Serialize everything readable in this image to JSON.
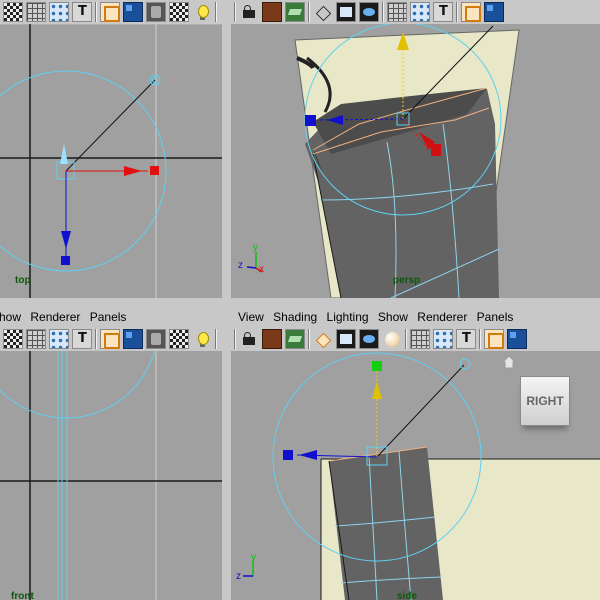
{
  "panes": {
    "top": {
      "label": "top"
    },
    "persp": {
      "label": "persp"
    },
    "front": {
      "label": "front",
      "menu": [
        "how",
        "Renderer",
        "Panels"
      ]
    },
    "side": {
      "label": "side",
      "menu": [
        "View",
        "Shading",
        "Lighting",
        "Show",
        "Renderer",
        "Panels"
      ],
      "viewcube_label": "RIGHT"
    }
  },
  "axes": {
    "x": "x",
    "y": "y",
    "z": "z"
  },
  "colors": {
    "viewport_bg": "#a0a0a0",
    "ui_bg": "#c8c8c8",
    "manip_circle": "#5fd0f0",
    "image_plane": "#e8e8c8",
    "axis_x": "#d01010",
    "axis_y": "#10c010",
    "axis_z": "#1010d0",
    "mesh": "#606060"
  },
  "toolbar_icons": {
    "top": [
      "checker-icon",
      "grid-icon",
      "dots-icon",
      "text-icon",
      "separator",
      "cube-outline-icon",
      "cube-blue-icon",
      "cube-gray-icon",
      "checker-icon",
      "bulb-icon",
      "separator"
    ],
    "persp": [
      "separator",
      "camera-icon",
      "book-icon",
      "layers-icon",
      "separator",
      "diamond-icon",
      "film-icon",
      "eye-icon",
      "separator",
      "grid-icon",
      "dots-icon",
      "text-icon",
      "separator",
      "cube-outline-icon",
      "cube-blue-icon"
    ],
    "front": [
      "checker-icon",
      "grid-icon",
      "dots-icon",
      "text-icon",
      "separator",
      "cube-outline-icon",
      "cube-blue-icon",
      "cube-gray-icon",
      "checker-icon",
      "bulb-icon",
      "separator"
    ],
    "side": [
      "separator",
      "camera-icon",
      "book-icon",
      "layers-icon",
      "separator",
      "diamond-orange-icon",
      "film-icon",
      "eye-icon",
      "sphere-icon",
      "separator",
      "grid-icon",
      "dots-icon",
      "text-icon",
      "separator",
      "cube-outline-icon",
      "cube-blue-icon"
    ]
  }
}
